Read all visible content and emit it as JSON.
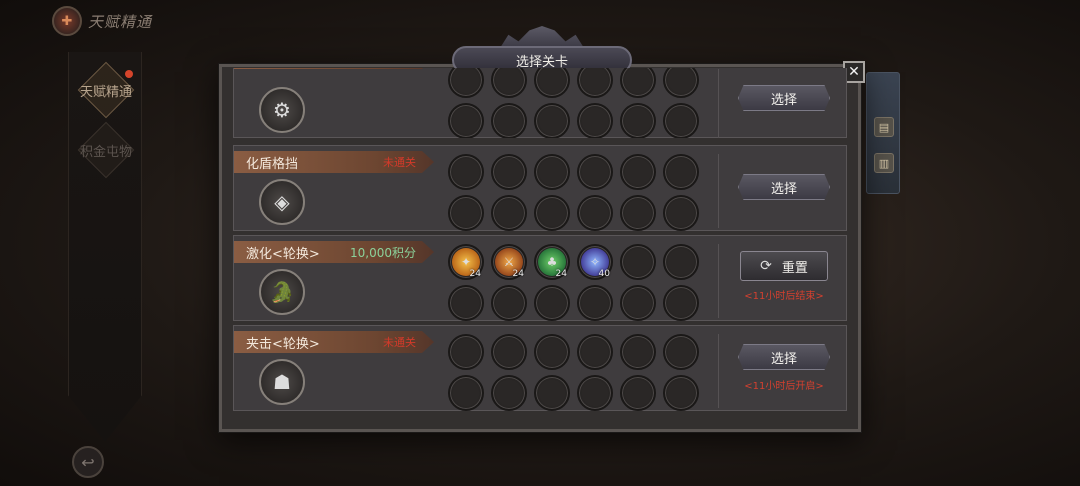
{
  "top_title": "天赋精通",
  "sidebar": {
    "items": [
      {
        "label": "天赋精通",
        "active": true
      },
      {
        "label": "积金屯物",
        "active": false
      }
    ]
  },
  "modal": {
    "title": "选择关卡",
    "close_symbol": "✕",
    "rows": [
      {
        "name": "",
        "status": "",
        "button": "选择",
        "note": "",
        "portrait_icon": "clockwork-orb-icon",
        "slots": [
          "",
          "",
          "",
          "",
          "",
          "",
          "",
          "",
          "",
          "",
          "",
          ""
        ]
      },
      {
        "name": "化盾格挡",
        "status": "未通关",
        "button": "选择",
        "note": "",
        "portrait_icon": "shield-golem-icon",
        "slots": [
          "",
          "",
          "",
          "",
          "",
          "",
          "",
          "",
          "",
          "",
          "",
          ""
        ]
      },
      {
        "name": "激化<轮换>",
        "status": "10,000积分",
        "button": "重置",
        "note": "<11小时后结束>",
        "portrait_icon": "crocodile-warrior-icon",
        "slots": [
          "24",
          "24",
          "24",
          "40",
          "",
          "",
          "",
          "",
          "",
          "",
          "",
          ""
        ]
      },
      {
        "name": "夹击<轮换>",
        "status": "未通关",
        "button": "选择",
        "note": "<11小时后开启>",
        "portrait_icon": "goblin-hero-icon",
        "slots": [
          "",
          "",
          "",
          "",
          "",
          "",
          "",
          "",
          "",
          "",
          "",
          ""
        ]
      }
    ]
  },
  "colors": {
    "status_locked": "#d33a2a",
    "status_points": "#8bd19a",
    "note": "#d4402f"
  }
}
